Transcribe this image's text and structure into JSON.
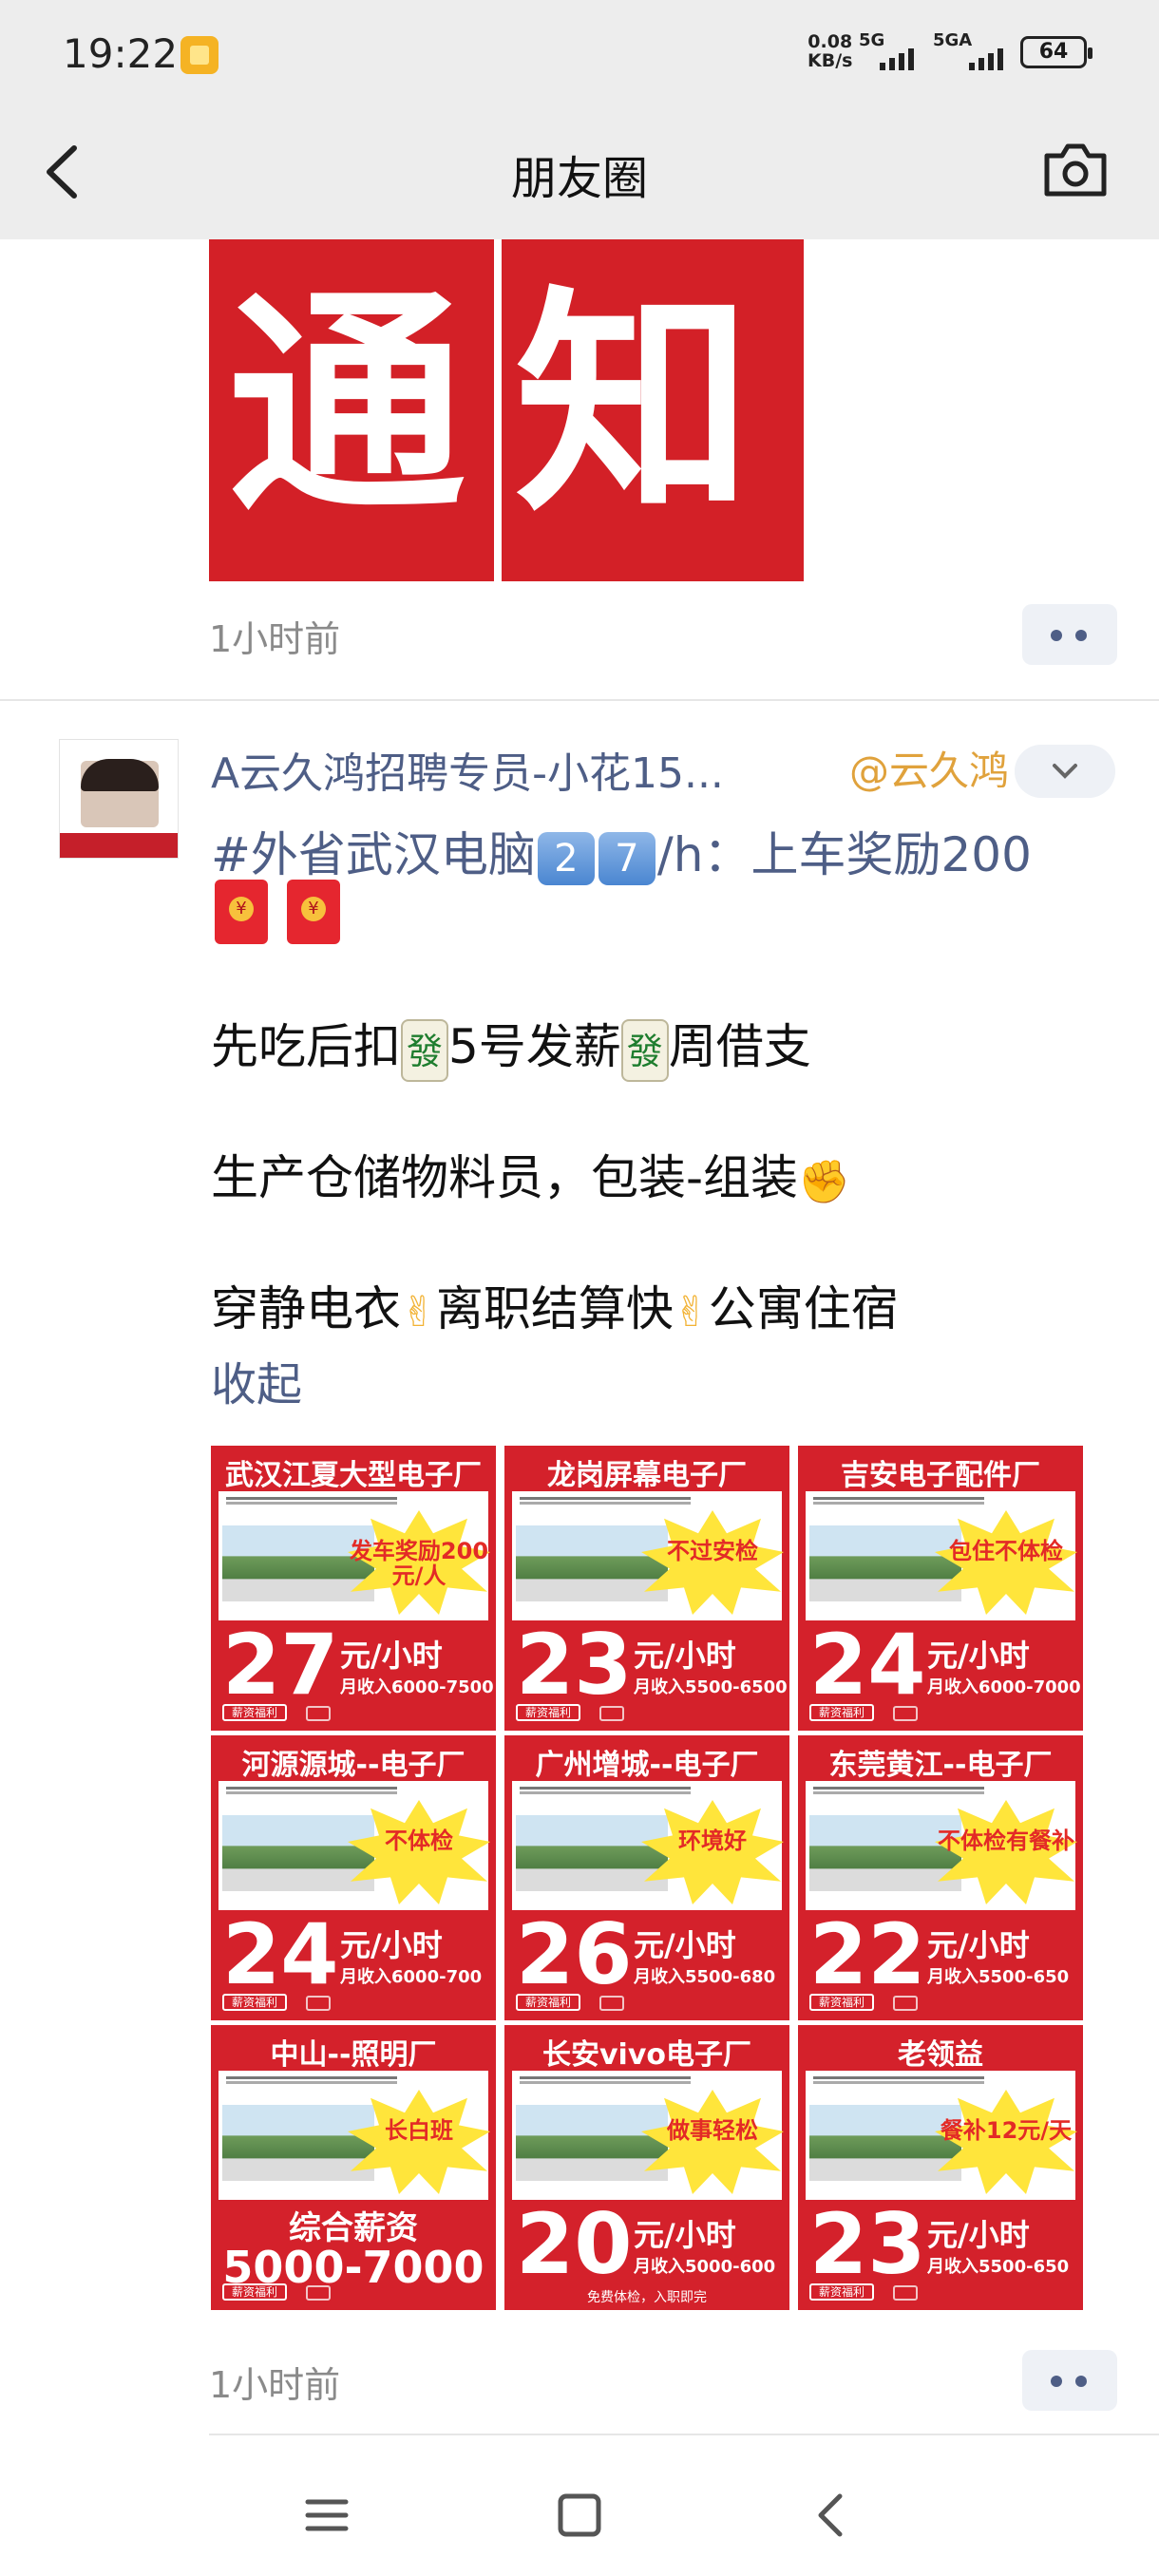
{
  "status_bar": {
    "time": "19:22",
    "speed_value": "0.08",
    "speed_unit": "KB/s",
    "net1": "5G",
    "net2": "5GA",
    "battery": "64"
  },
  "nav": {
    "title": "朋友圈",
    "back_icon": "chevron-left-icon",
    "camera_icon": "camera-icon"
  },
  "post1": {
    "image_text": [
      "通",
      "知"
    ],
    "time": "1小时前"
  },
  "post2": {
    "author": "A云久鸿招聘专员-小花15...",
    "mention": "@云久鸿",
    "hashtag_prefix": "#外省武汉电脑",
    "hashtag_key1": "2",
    "hashtag_key2": "7",
    "hashtag_suffix": "/h：上车奖励200",
    "line1": {
      "a": "先吃后扣",
      "b": "5号发薪",
      "c": "周借支",
      "tile": "發"
    },
    "line2": "生产仓储物料员，包装-组装",
    "line3": {
      "a": "穿静电衣",
      "b": "离职结算快",
      "c": "公寓住宿"
    },
    "collapse": "收起",
    "time": "1小时前",
    "posters": [
      {
        "title": "武汉江夏大型电子厂",
        "badge": "发车奖励200元/人",
        "wage": "27",
        "unit": "元/小时",
        "income": "月收入6000-7500",
        "footer": "薪资福利"
      },
      {
        "title": "龙岗屏幕电子厂",
        "badge": "不过安检",
        "wage": "23",
        "unit": "元/小时",
        "income": "月收入5500-6500",
        "footer": "薪资福利"
      },
      {
        "title": "吉安电子配件厂",
        "badge": "包住不体检",
        "wage": "24",
        "unit": "元/小时",
        "income": "月收入6000-7000",
        "footer": "薪资福利"
      },
      {
        "title": "河源源城--电子厂",
        "badge": "不体检",
        "wage": "24",
        "unit": "元/小时",
        "income": "月收入6000-700",
        "footer": "薪资福利"
      },
      {
        "title": "广州增城--电子厂",
        "badge": "环境好",
        "wage": "26",
        "unit": "元/小时",
        "income": "月收入5500-680",
        "footer": "薪资福利"
      },
      {
        "title": "东莞黄江--电子厂",
        "badge": "不体检有餐补",
        "wage": "22",
        "unit": "元/小时",
        "income": "月收入5500-650",
        "footer": "薪资福利"
      },
      {
        "title": "中山--照明厂",
        "badge": "长白班",
        "total_label": "综合薪资",
        "total_range": "5000-7000",
        "footer": "薪资福利"
      },
      {
        "title": "长安vivo电子厂",
        "badge": "做事轻松",
        "wage": "20",
        "unit": "元/小时",
        "income": "月收入5000-600",
        "footer": "薪资福利",
        "note": "免费体检，入职即完"
      },
      {
        "title": "老领益",
        "badge": "餐补12元/天",
        "wage": "23",
        "unit": "元/小时",
        "income": "月收入5500-650",
        "footer": "薪资福利"
      }
    ]
  },
  "colors": {
    "link": "#4e5e86",
    "mention": "#e0a23c",
    "poster_red": "#d4212b",
    "burst_yellow": "#ffe53b"
  },
  "system_nav": {
    "menu_icon": "menu-icon",
    "home_icon": "home-icon",
    "back_icon": "back-icon"
  }
}
